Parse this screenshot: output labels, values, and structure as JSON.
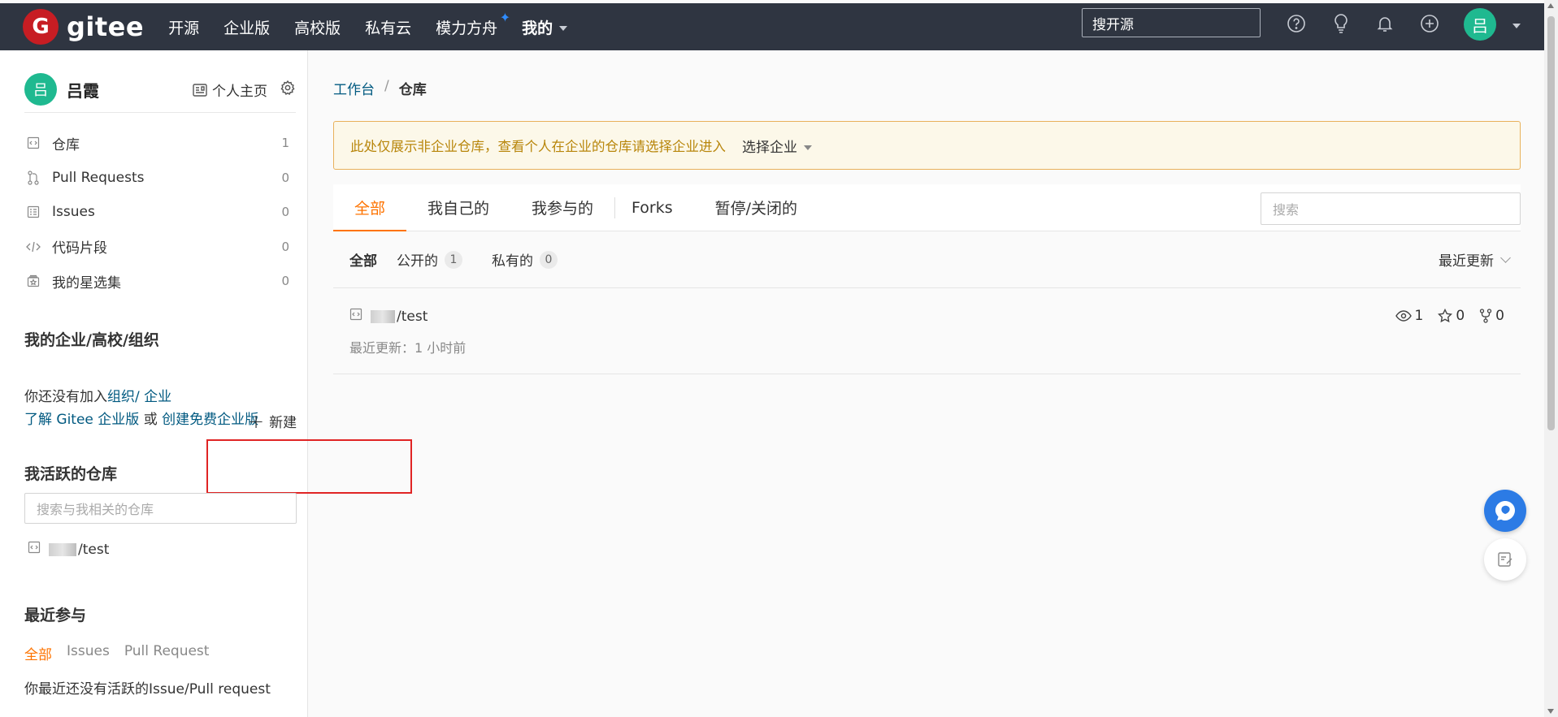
{
  "brand": {
    "logo_letter": "G",
    "name": "gitee"
  },
  "topnav": {
    "items": [
      "开源",
      "企业版",
      "高校版",
      "私有云",
      "模力方舟",
      "我的"
    ],
    "search_label": "搜开源",
    "avatar_letter": "吕"
  },
  "sidebar": {
    "user": {
      "avatar_letter": "吕",
      "name": "吕霞"
    },
    "home_link": "个人主页",
    "menu": [
      {
        "label": "仓库",
        "count": "1",
        "icon": "repo-icon"
      },
      {
        "label": "Pull Requests",
        "count": "0",
        "icon": "pull-request-icon"
      },
      {
        "label": "Issues",
        "count": "0",
        "icon": "issues-icon"
      },
      {
        "label": "代码片段",
        "count": "0",
        "icon": "code-snippet-icon"
      },
      {
        "label": "我的星选集",
        "count": "0",
        "icon": "star-collection-icon"
      }
    ],
    "org_heading": "我的企业/高校/组织",
    "org_text_prefix": "你还没有加入",
    "org_link_org": "组织",
    "org_slash": "/",
    "org_link_ent": " 企业",
    "learn_link": "了解 Gitee 企业版",
    "or_text": " 或 ",
    "create_link": "创建免费企业版",
    "active_heading": "我活跃的仓库",
    "new_label": "新建",
    "search_placeholder": "搜索与我相关的仓库",
    "active_repo_suffix": "/test",
    "recent_heading": "最近参与",
    "recent_tabs": [
      "全部",
      "Issues",
      "Pull Request"
    ],
    "recent_empty": "你最近还没有活跃的Issue/Pull request"
  },
  "main": {
    "breadcrumb": {
      "root": "工作台",
      "sep": "/",
      "current": "仓库"
    },
    "notice": {
      "message": "此处仅展示非企业仓库，查看个人在企业的仓库请选择企业进入",
      "select_label": "选择企业"
    },
    "tabs": [
      "全部",
      "我自己的",
      "我参与的",
      "Forks",
      "暂停/关闭的"
    ],
    "search_placeholder": "搜索",
    "filters": {
      "all": "全部",
      "public": "公开的",
      "public_count": "1",
      "private": "私有的",
      "private_count": "0"
    },
    "sort_label": "最近更新",
    "repo": {
      "name_suffix": "/test",
      "updated": "最近更新：1 小时前",
      "watch": "1",
      "star": "0",
      "fork": "0"
    }
  },
  "colors": {
    "accent": "#fe7300",
    "nav_bg": "#2f3541",
    "brand_red": "#c71d23",
    "link": "#005980",
    "avatar": "#1fb990"
  }
}
